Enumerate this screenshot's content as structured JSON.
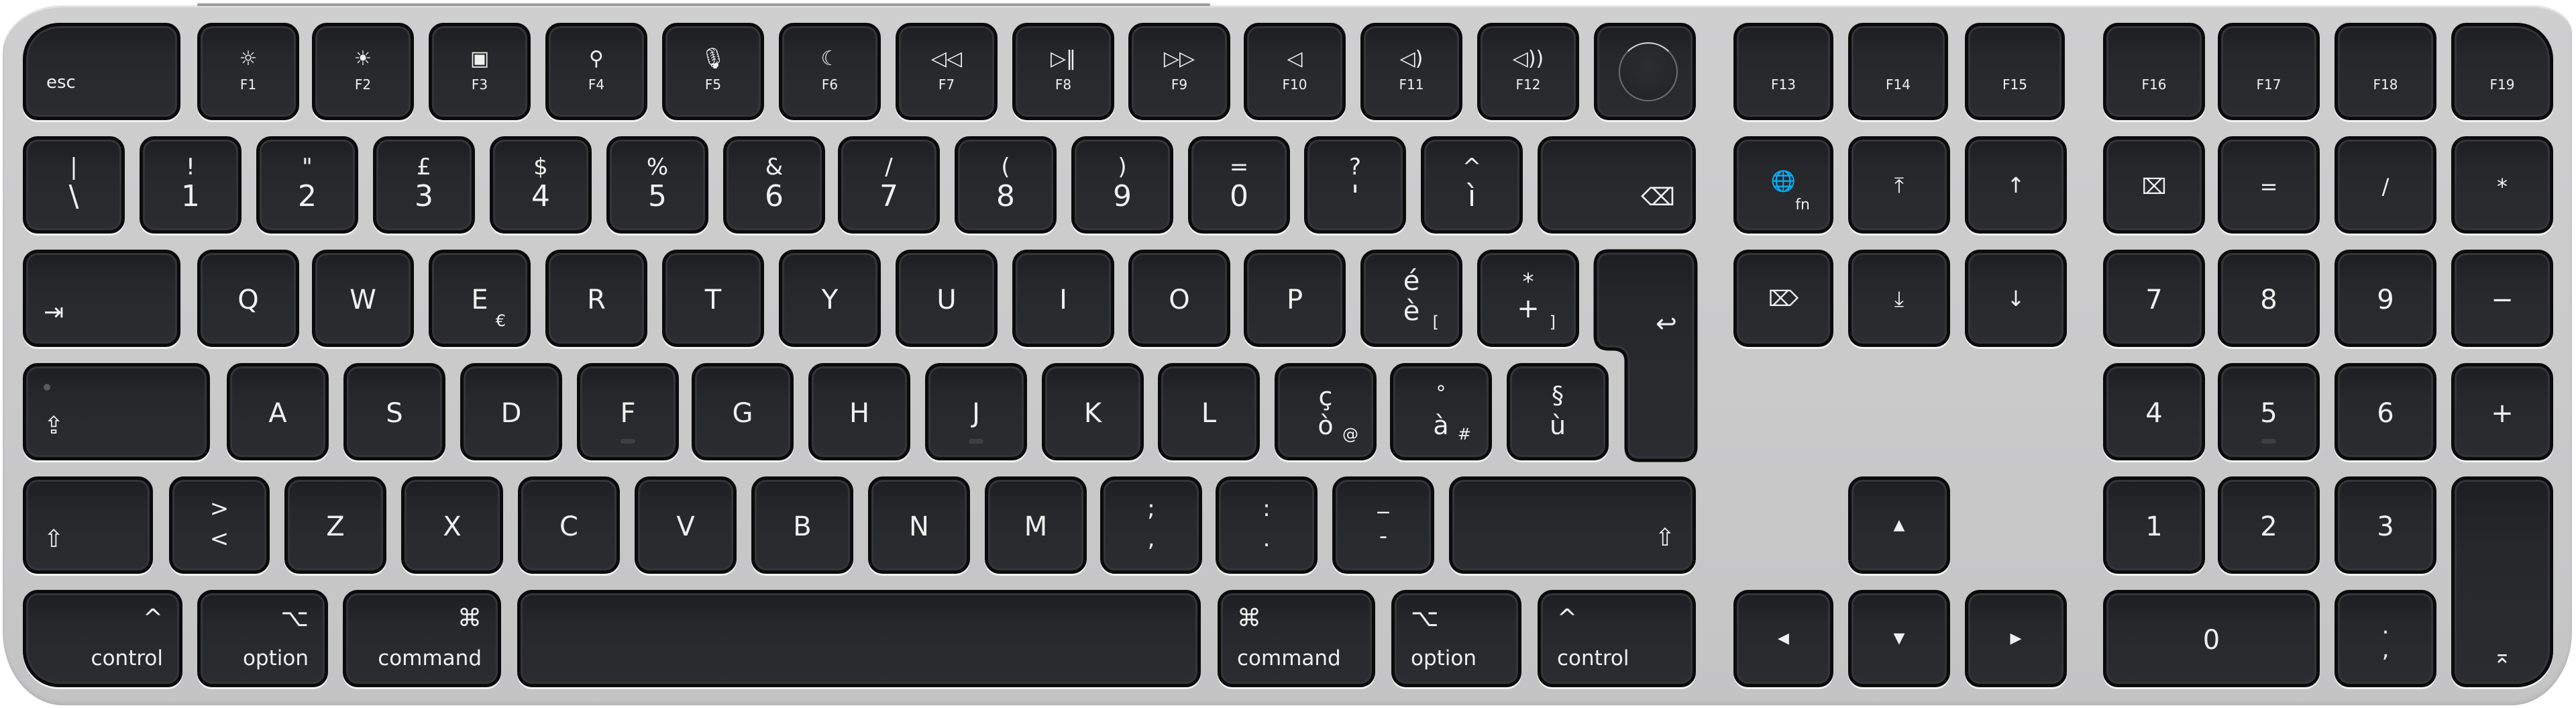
{
  "product": "Magic Keyboard with Touch ID and Numeric Keypad (Italian layout)",
  "colors": {
    "body": "#c9c9ca",
    "key": "#26272b",
    "legend": "#f0f0f0"
  },
  "function_row": {
    "esc": "esc",
    "keys": [
      {
        "label": "F1",
        "icon": "brightness-down-icon",
        "glyph": "☼"
      },
      {
        "label": "F2",
        "icon": "brightness-up-icon",
        "glyph": "☀"
      },
      {
        "label": "F3",
        "icon": "mission-control-icon",
        "glyph": "▣"
      },
      {
        "label": "F4",
        "icon": "search-icon",
        "glyph": "⚲"
      },
      {
        "label": "F5",
        "icon": "dictation-icon",
        "glyph": "🎙"
      },
      {
        "label": "F6",
        "icon": "do-not-disturb-icon",
        "glyph": "☾"
      },
      {
        "label": "F7",
        "icon": "rewind-icon",
        "glyph": "◁◁"
      },
      {
        "label": "F8",
        "icon": "play-pause-icon",
        "glyph": "▷‖"
      },
      {
        "label": "F9",
        "icon": "fast-forward-icon",
        "glyph": "▷▷"
      },
      {
        "label": "F10",
        "icon": "mute-icon",
        "glyph": "◁"
      },
      {
        "label": "F11",
        "icon": "volume-down-icon",
        "glyph": "◁)"
      },
      {
        "label": "F12",
        "icon": "volume-up-icon",
        "glyph": "◁))"
      }
    ],
    "touch_id": "touch-id-sensor",
    "extended": [
      "F13",
      "F14",
      "F15",
      "F16",
      "F17",
      "F18",
      "F19"
    ]
  },
  "number_row": [
    {
      "top": "|",
      "bottom": "\\"
    },
    {
      "top": "!",
      "bottom": "1"
    },
    {
      "top": "\"",
      "bottom": "2"
    },
    {
      "top": "£",
      "bottom": "3"
    },
    {
      "top": "$",
      "bottom": "4"
    },
    {
      "top": "%",
      "bottom": "5"
    },
    {
      "top": "&",
      "bottom": "6"
    },
    {
      "top": "/",
      "bottom": "7"
    },
    {
      "top": "(",
      "bottom": "8"
    },
    {
      "top": ")",
      "bottom": "9"
    },
    {
      "top": "=",
      "bottom": "0"
    },
    {
      "top": "?",
      "bottom": "'"
    },
    {
      "top": "^",
      "bottom": "ì"
    }
  ],
  "delete_glyph": "⌫",
  "nav_cluster": {
    "fn_globe": {
      "glyph": "🌐",
      "label": "fn"
    },
    "home": "⤒",
    "page_up": "↑",
    "forward_delete": "⌦",
    "end": "⤓",
    "page_down": "↓"
  },
  "qwerty_row": {
    "tab_glyph": "⇥",
    "letters": [
      "Q",
      "W",
      "E",
      "R",
      "T",
      "Y",
      "U",
      "I",
      "O",
      "P"
    ],
    "e_alt": "€",
    "key_egrave": {
      "top": "é",
      "bottom": "è",
      "alt": "["
    },
    "key_plus": {
      "top": "*",
      "bottom": "+",
      "alt": "]"
    },
    "return_glyph": "↩"
  },
  "home_row": {
    "caps_glyph": "⇪",
    "letters": [
      "A",
      "S",
      "D",
      "F",
      "G",
      "H",
      "J",
      "K",
      "L"
    ],
    "key_ograve": {
      "top": "ç",
      "bottom": "ò",
      "alt": "@"
    },
    "key_agrave": {
      "top": "°",
      "bottom": "à",
      "alt": "#"
    },
    "key_ugrave": {
      "top": "§",
      "bottom": "ù"
    }
  },
  "bottom_letter_row": {
    "shift_glyph": "⇧",
    "key_angle": {
      "top": ">",
      "bottom": "<"
    },
    "letters": [
      "Z",
      "X",
      "C",
      "V",
      "B",
      "N",
      "M"
    ],
    "key_semicolon": {
      "top": ";",
      "bottom": ","
    },
    "key_colon": {
      "top": ":",
      "bottom": "."
    },
    "key_underscore": {
      "top": "_",
      "bottom": "-"
    },
    "right_shift_glyph": "⇧"
  },
  "modifier_row": {
    "left": [
      {
        "label": "control",
        "glyph": "^"
      },
      {
        "label": "option",
        "glyph": "⌥"
      },
      {
        "label": "command",
        "glyph": "⌘"
      }
    ],
    "right": [
      {
        "label": "command",
        "glyph": "⌘"
      },
      {
        "label": "option",
        "glyph": "⌥"
      },
      {
        "label": "control",
        "glyph": "^"
      }
    ]
  },
  "arrows": {
    "up": "▲",
    "left": "◀",
    "down": "▼",
    "right": "▶"
  },
  "numpad": {
    "row1": [
      "⌧",
      "=",
      "/",
      "*"
    ],
    "row2": [
      "7",
      "8",
      "9",
      "−"
    ],
    "row3": [
      "4",
      "5",
      "6",
      "+"
    ],
    "row4": [
      "1",
      "2",
      "3"
    ],
    "row5": [
      "0",
      {
        "top": ".",
        "bottom": ","
      }
    ],
    "enter_glyph": "⌅",
    "comma_top": ".",
    "comma_bottom": ","
  }
}
